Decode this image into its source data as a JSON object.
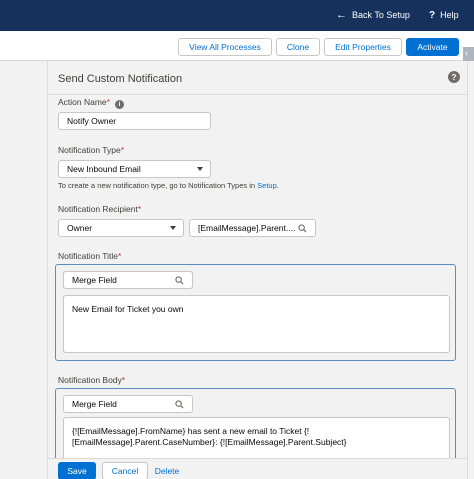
{
  "topbar": {
    "back_label": "Back To Setup",
    "help_label": "Help"
  },
  "toolbar": {
    "view_all_label": "View All Processes",
    "clone_label": "Clone",
    "edit_props_label": "Edit Properties",
    "activate_label": "Activate"
  },
  "panel": {
    "title": "Send Custom Notification",
    "action_name": {
      "label": "Action Name",
      "required": "*",
      "value": "Notify Owner"
    },
    "notification_type": {
      "label": "Notification Type",
      "required": "*",
      "value": "New Inbound Email",
      "help_prefix": "To create a new notification type, go to Notification Types in ",
      "help_link": "Setup",
      "help_suffix": "."
    },
    "recipient": {
      "label": "Notification Recipient",
      "required": "*",
      "select_value": "Owner",
      "lookup_value": "[EmailMessage].Parent...."
    },
    "title_field": {
      "label": "Notification Title",
      "required": "*",
      "merge_placeholder": "Merge Field",
      "text": "New Email for Ticket you own"
    },
    "body_field": {
      "label": "Notification Body",
      "required": "*",
      "merge_placeholder": "Merge Field",
      "text_line1": "{![EmailMessage].FromName} has sent a new email to Ticket {!",
      "text_line2": "[EmailMessage].Parent.CaseNumber}: {![EmailMessage].Parent.Subject}"
    }
  },
  "footer": {
    "save_label": "Save",
    "cancel_label": "Cancel",
    "delete_label": "Delete"
  },
  "colors": {
    "header_navy": "#16325c",
    "brand_blue": "#0070d2",
    "required_red": "#c23934"
  },
  "icons": {
    "back": "left-arrow-icon",
    "help": "question-icon",
    "info": "info-icon",
    "search": "search-icon",
    "dropdown": "chevron-down-icon"
  }
}
